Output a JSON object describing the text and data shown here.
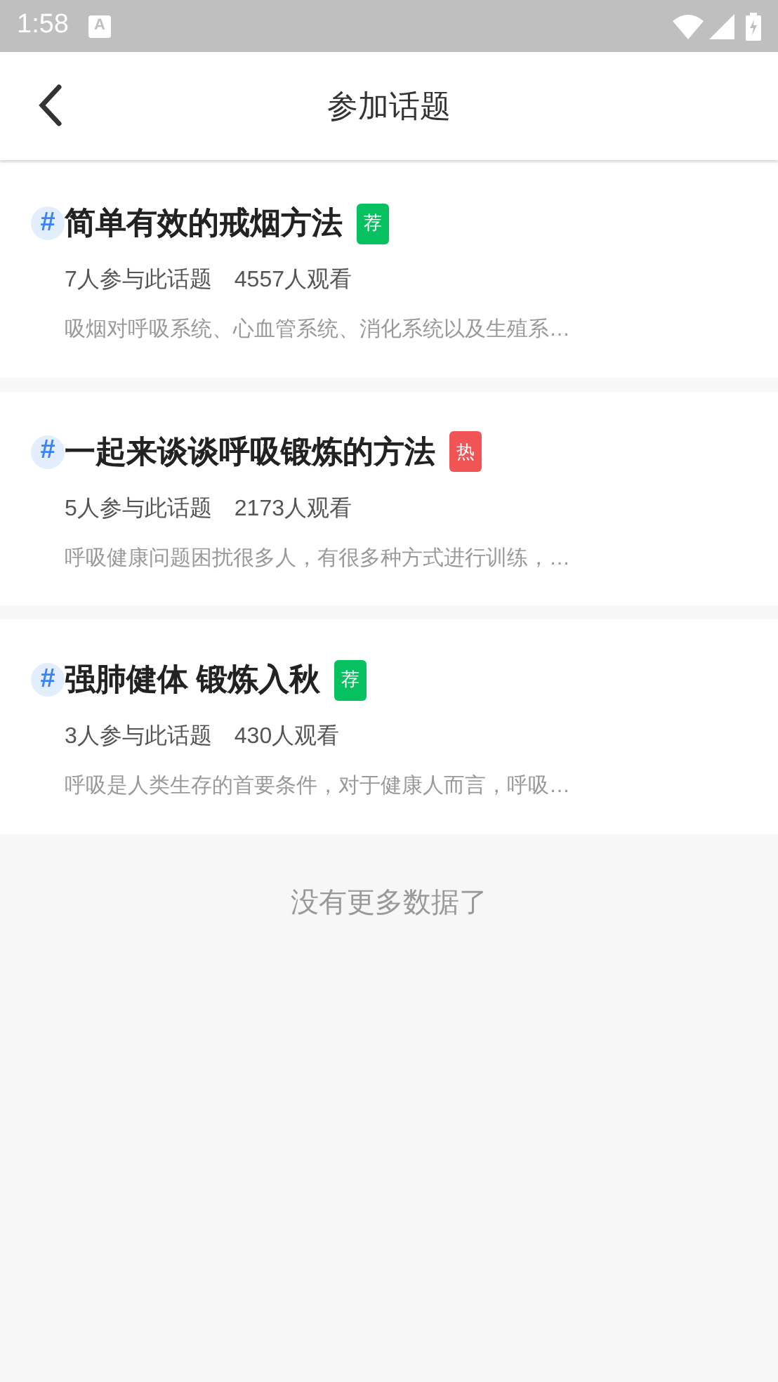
{
  "status_bar": {
    "time": "1:58",
    "notification": "A"
  },
  "header": {
    "title": "参加话题"
  },
  "topics": [
    {
      "hash": "#",
      "title": "简单有效的戒烟方法",
      "badge": {
        "text": "荐",
        "color": "#07c160"
      },
      "participants": "7人参与此话题",
      "views": "4557人观看",
      "description": "吸烟对呼吸系统、心血管系统、消化系统以及生殖系…"
    },
    {
      "hash": "#",
      "title": "一起来谈谈呼吸锻炼的方法",
      "badge": {
        "text": "热",
        "color": "#f05454"
      },
      "participants": "5人参与此话题",
      "views": "2173人观看",
      "description": "呼吸健康问题困扰很多人，有很多种方式进行训练，…"
    },
    {
      "hash": "#",
      "title": "强肺健体 锻炼入秋",
      "badge": {
        "text": "荐",
        "color": "#07c160"
      },
      "participants": "3人参与此话题",
      "views": "430人观看",
      "description": "呼吸是人类生存的首要条件，对于健康人而言，呼吸…"
    }
  ],
  "footer": "没有更多数据了"
}
